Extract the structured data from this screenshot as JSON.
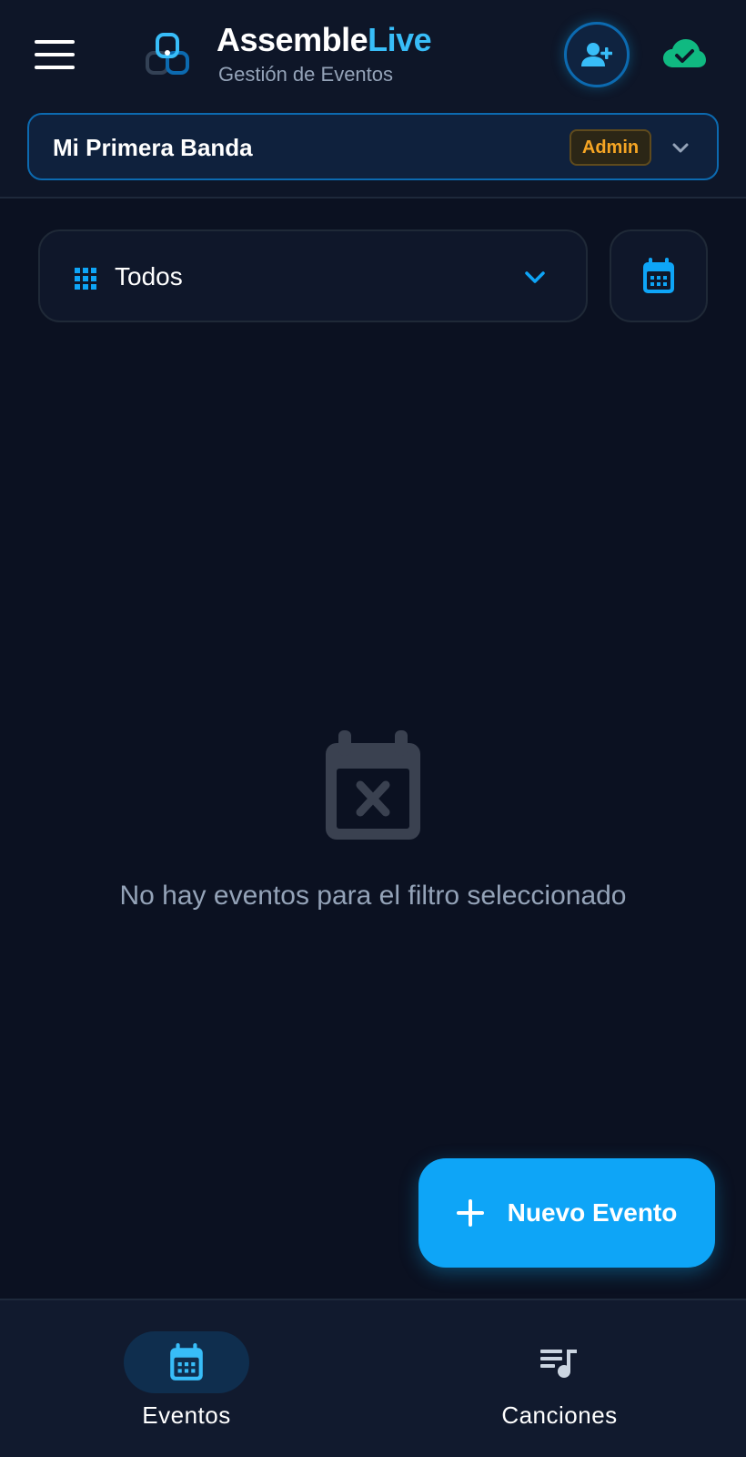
{
  "header": {
    "menu_icon": "hamburger-menu-icon",
    "logo_icon": "assemblelive-logo",
    "brand_name_primary": "Assemble",
    "brand_name_accent": "Live",
    "brand_subtitle": "Gestión de Eventos",
    "invite_icon": "person-add-icon",
    "sync_icon": "cloud-check-icon"
  },
  "band_selector": {
    "name": "Mi Primera Banda",
    "role": "Admin",
    "chevron_icon": "chevron-down-icon"
  },
  "filter": {
    "icon": "grid-icon",
    "selected": "Todos",
    "chevron_icon": "chevron-down-icon",
    "calendar_icon": "calendar-icon"
  },
  "empty_state": {
    "icon": "calendar-x-icon",
    "message": "No hay eventos para el filtro seleccionado"
  },
  "fab": {
    "icon": "plus-icon",
    "label": "Nuevo Evento"
  },
  "bottom_nav": {
    "items": [
      {
        "label": "Eventos",
        "icon": "calendar-icon",
        "active": true
      },
      {
        "label": "Canciones",
        "icon": "music-queue-icon",
        "active": false
      }
    ]
  },
  "colors": {
    "background": "#0b1121",
    "accent": "#0ea5f7",
    "accent_light": "#38bdf8",
    "admin_badge": "#f5a524",
    "sync_ok": "#10b981",
    "muted_text": "#94a3b8"
  }
}
